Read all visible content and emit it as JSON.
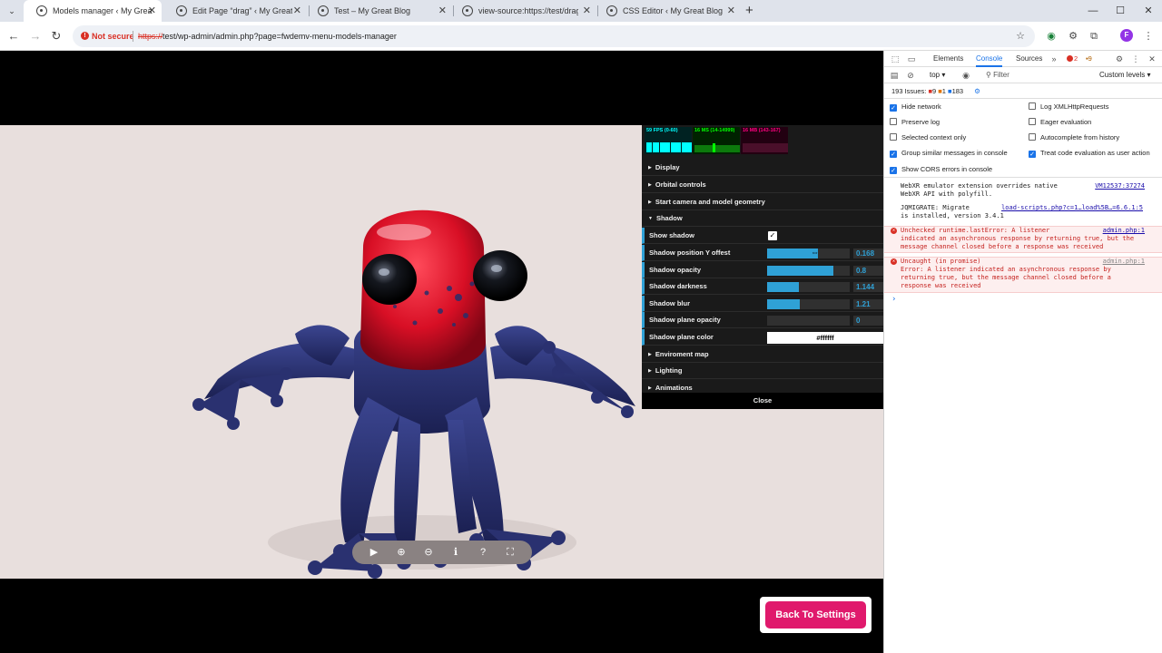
{
  "browser": {
    "tabs": [
      {
        "title": "Models manager ‹ My Great Bl",
        "active": true
      },
      {
        "title": "Edit Page “drag” ‹ My Great Blo",
        "active": false
      },
      {
        "title": "Test – My Great Blog",
        "active": false
      },
      {
        "title": "view-source:https://test/drag/?",
        "active": false
      },
      {
        "title": "CSS Editor ‹ My Great Blog — V",
        "active": false
      }
    ],
    "security_label": "Not secure",
    "url_scheme": "https://",
    "url_rest": "test/wp-admin/admin.php?page=fwdemv-menu-models-manager",
    "profile_initial": "F"
  },
  "viewer": {
    "stats": [
      {
        "label": "59 FPS (0-60)",
        "color": "#00ffff"
      },
      {
        "label": "16 MS (14-14999)",
        "color": "#00ff00"
      },
      {
        "label": "16 MB (143-167)",
        "color": "#ff0080"
      }
    ],
    "folders_top": [
      {
        "label": "Display"
      },
      {
        "label": "Orbital controls"
      },
      {
        "label": "Start camera and model geometry"
      },
      {
        "label": "Shadow",
        "open": true
      }
    ],
    "shadow_rows": {
      "show_shadow": {
        "label": "Show shadow",
        "checked": true
      },
      "sliders": [
        {
          "label": "Shadow position Y offest",
          "value": "0.168",
          "fill": 0.62
        },
        {
          "label": "Shadow opacity",
          "value": "0.8",
          "fill": 0.8
        },
        {
          "label": "Shadow darkness",
          "value": "1.144",
          "fill": 0.38
        },
        {
          "label": "Shadow blur",
          "value": "1.21",
          "fill": 0.4
        },
        {
          "label": "Shadow plane opacity",
          "value": "0",
          "fill": 0
        }
      ],
      "plane_color": {
        "label": "Shadow plane color",
        "value": "#ffffff"
      }
    },
    "folders_bottom": [
      {
        "label": "Enviroment map"
      },
      {
        "label": "Lighting"
      },
      {
        "label": "Animations"
      }
    ],
    "close_label": "Close",
    "back_button": "Back To Settings"
  },
  "devtools": {
    "tabs": [
      "Elements",
      "Console",
      "Sources"
    ],
    "active_tab": "Console",
    "error_count": "2",
    "warn_count": "9",
    "context": "top",
    "filter_placeholder": "Filter",
    "levels": "Custom levels",
    "issues": {
      "label": "193 Issues:",
      "errors": "9",
      "warnings": "1",
      "info": "183"
    },
    "options_left": [
      {
        "label": "Hide network",
        "checked": true
      },
      {
        "label": "Preserve log",
        "checked": false
      },
      {
        "label": "Selected context only",
        "checked": false
      },
      {
        "label": "Group similar messages in console",
        "checked": true
      },
      {
        "label": "Show CORS errors in console",
        "checked": true
      }
    ],
    "options_right": [
      {
        "label": "Log XMLHttpRequests",
        "checked": false
      },
      {
        "label": "Eager evaluation",
        "checked": false
      },
      {
        "label": "Autocomplete from history",
        "checked": false
      },
      {
        "label": "Treat code evaluation as user action",
        "checked": true
      }
    ],
    "messages": [
      {
        "type": "info",
        "lines": [
          "WebXR emulator extension overrides native",
          "WebXR API with polyfill."
        ],
        "source": "VM12537:37274"
      },
      {
        "type": "info",
        "lines": [
          "JQMIGRATE: Migrate",
          "is installed, version 3.4.1"
        ],
        "source": "load-scripts.php?c=1…load%5B…=6.6.1:5"
      },
      {
        "type": "error",
        "lines": [
          "Unchecked runtime.lastError: A listener",
          "indicated an asynchronous response by returning true, but the",
          "message channel closed before a response was received"
        ],
        "source": "admin.php:1"
      },
      {
        "type": "error",
        "lines": [
          "Uncaught (in promise)",
          "Error: A listener indicated an asynchronous response by",
          "returning true, but the message channel closed before a",
          "response was received"
        ],
        "source": "admin.php:1"
      }
    ]
  }
}
